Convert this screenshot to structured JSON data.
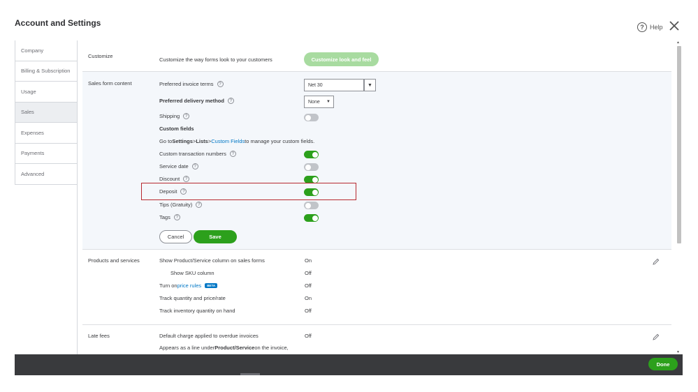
{
  "header": {
    "title": "Account and Settings",
    "help_label": "Help"
  },
  "sidebar": {
    "items": [
      {
        "label": "Company"
      },
      {
        "label": "Billing & Subscription"
      },
      {
        "label": "Usage"
      },
      {
        "label": "Sales"
      },
      {
        "label": "Expenses"
      },
      {
        "label": "Payments"
      },
      {
        "label": "Advanced"
      }
    ]
  },
  "customize": {
    "label": "Customize",
    "description": "Customize the way forms look to your customers",
    "button": "Customize look and feel"
  },
  "sales_form": {
    "label": "Sales form content",
    "invoice_terms_label": "Preferred invoice terms",
    "invoice_terms_value": "Net 30",
    "delivery_label": "Preferred delivery method",
    "delivery_value": "None",
    "shipping_label": "Shipping",
    "custom_fields_heading": "Custom fields",
    "goto_prefix": "Go to ",
    "goto_settings": "Settings",
    "goto_sep": " > ",
    "goto_lists": "Lists",
    "goto_link": "Custom Fields",
    "goto_suffix": " to manage your custom fields.",
    "custom_txn_label": "Custom transaction numbers",
    "service_date_label": "Service date",
    "discount_label": "Discount",
    "deposit_label": "Deposit",
    "tips_label": "Tips (Gratuity)",
    "tags_label": "Tags",
    "cancel": "Cancel",
    "save": "Save"
  },
  "products": {
    "label": "Products and services",
    "show_col_label": "Show Product/Service column on sales forms",
    "show_col_value": "On",
    "sku_label": "Show SKU column",
    "sku_value": "Off",
    "price_rules_prefix": "Turn on ",
    "price_rules_link": "price rules",
    "beta": "BETA",
    "price_rules_value": "Off",
    "track_qty_label": "Track quantity and price/rate",
    "track_qty_value": "On",
    "track_inv_label": "Track inventory quantity on hand",
    "track_inv_value": "Off"
  },
  "late_fees": {
    "label": "Late fees",
    "default_label": "Default charge applied to overdue invoices",
    "default_value": "Off",
    "appears_prefix": "Appears as a line under ",
    "appears_bold": "Product/Service",
    "appears_suffix": " on the invoice,"
  },
  "footer": {
    "done": "Done"
  },
  "colors": {
    "accent": "#2ca01c",
    "link": "#0077c5",
    "highlight": "#b7282e"
  }
}
